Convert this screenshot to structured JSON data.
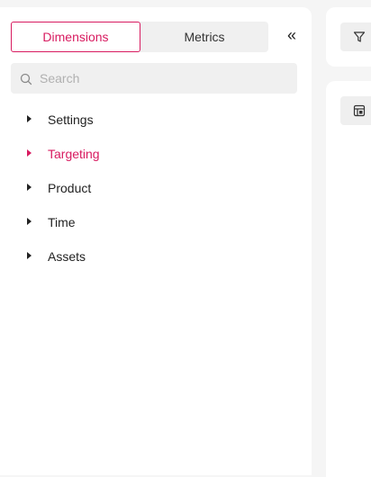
{
  "tabs": {
    "dimensions_label": "Dimensions",
    "metrics_label": "Metrics"
  },
  "collapse_glyph": "«",
  "search": {
    "placeholder": "Search",
    "value": ""
  },
  "tree": {
    "items": [
      {
        "label": "Settings",
        "active": false
      },
      {
        "label": "Targeting",
        "active": true
      },
      {
        "label": "Product",
        "active": false
      },
      {
        "label": "Time",
        "active": false
      },
      {
        "label": "Assets",
        "active": false
      }
    ]
  },
  "icons": {
    "search": "search-icon",
    "collapse": "double-chevron-left-icon",
    "caret": "caret-right-icon",
    "filter": "filter-icon",
    "table": "table-settings-icon"
  },
  "colors": {
    "accent": "#d81b60",
    "text": "#222222",
    "panel_bg": "#ffffff",
    "page_bg": "#f5f5f5",
    "control_bg": "#f0f0f0"
  }
}
